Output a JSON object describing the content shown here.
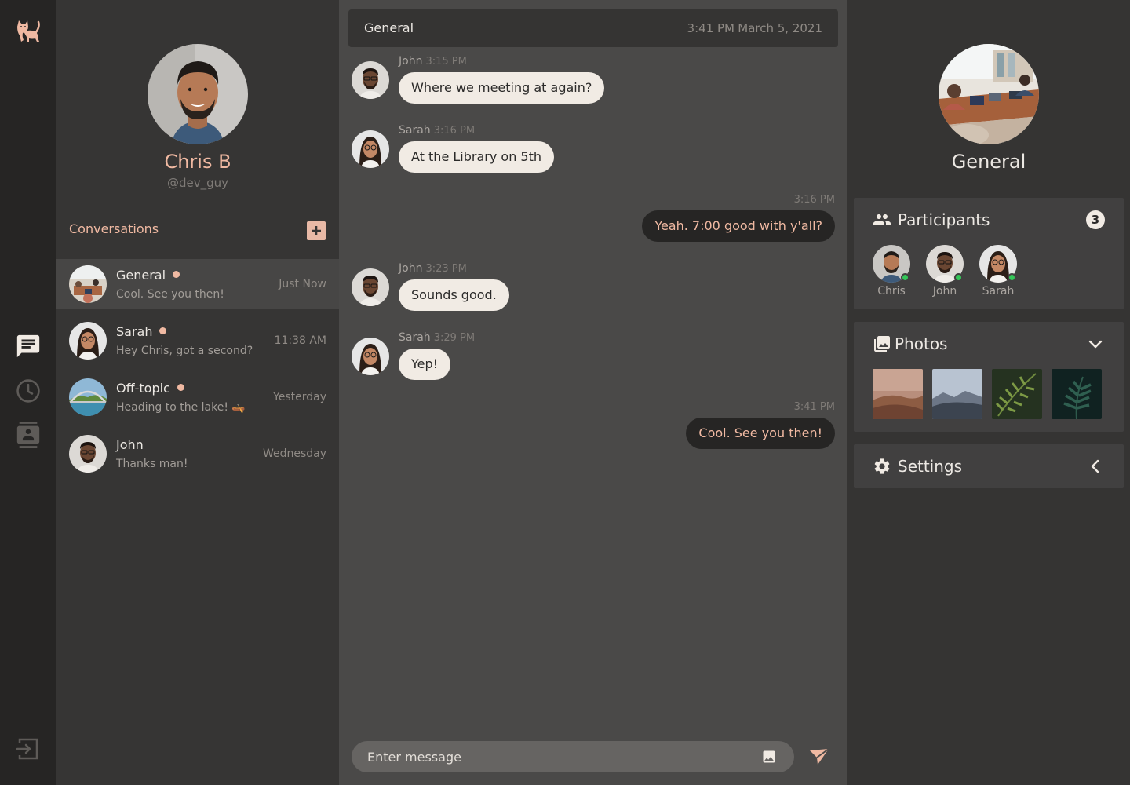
{
  "profile": {
    "name": "Chris B",
    "handle": "@dev_guy"
  },
  "conversations": {
    "header": "Conversations",
    "items": [
      {
        "name": "General",
        "preview": "Cool. See you then!",
        "time": "Just Now",
        "unread": true
      },
      {
        "name": "Sarah",
        "preview": "Hey Chris, got a second?",
        "time": "11:38 AM",
        "unread": true
      },
      {
        "name": "Off-topic",
        "preview": "Heading to the lake! 🛶",
        "time": "Yesterday",
        "unread": true
      },
      {
        "name": "John",
        "preview": "Thanks man!",
        "time": "Wednesday",
        "unread": false
      }
    ]
  },
  "chat": {
    "title": "General",
    "time": "3:41 PM",
    "date": "March 5, 2021",
    "messages": [
      {
        "author": "John",
        "time": "3:15 PM",
        "text": "Where we meeting at again?",
        "outgoing": false
      },
      {
        "author": "Sarah",
        "time": "3:16 PM",
        "text": "At the Library on 5th",
        "outgoing": false
      },
      {
        "author": "",
        "time": "3:16 PM",
        "text": "Yeah. 7:00 good with y'all?",
        "outgoing": true
      },
      {
        "author": "John",
        "time": "3:23 PM",
        "text": "Sounds good.",
        "outgoing": false
      },
      {
        "author": "Sarah",
        "time": "3:29 PM",
        "text": "Yep!",
        "outgoing": false
      },
      {
        "author": "",
        "time": "3:41 PM",
        "text": "Cool. See you then!",
        "outgoing": true
      }
    ],
    "composer_placeholder": "Enter message"
  },
  "details": {
    "group_name": "General",
    "participants_title": "Participants",
    "participant_count": "3",
    "participants": [
      "Chris",
      "John",
      "Sarah"
    ],
    "photos_title": "Photos",
    "settings_title": "Settings"
  },
  "icons": {
    "logo": "cat-icon",
    "nav": [
      "chat-icon",
      "clock-icon",
      "contacts-icon"
    ],
    "logout": "logout-icon"
  },
  "colors": {
    "accent": "#f0b9a2",
    "online": "#34c759"
  }
}
